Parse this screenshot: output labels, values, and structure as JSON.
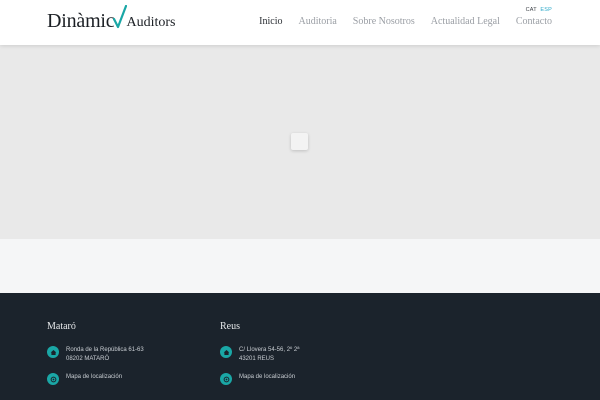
{
  "brand": {
    "name": "Dinàmic",
    "sub": "Auditors",
    "check_color": "#1aa7a6"
  },
  "languages": {
    "cat": "CAT",
    "esp": "ESP"
  },
  "nav": {
    "items": [
      {
        "label": "Inicio",
        "active": true
      },
      {
        "label": "Auditoria",
        "active": false
      },
      {
        "label": "Sobre Nosotros",
        "active": false
      },
      {
        "label": "Actualidad Legal",
        "active": false
      },
      {
        "label": "Contacto",
        "active": false
      }
    ]
  },
  "footer": {
    "offices": [
      {
        "name": "Mataró",
        "address_line1": "Ronda de la República 61-63",
        "address_line2": "08202 MATARÓ",
        "map_label": "Mapa de localización"
      },
      {
        "name": "Reus",
        "address_line1": "C/ Llovera 54-56, 2º 2ª",
        "address_line2": "43201 REUS",
        "map_label": "Mapa de localización"
      }
    ],
    "icon_color": "#1aa7a6",
    "background": "#1b232c"
  }
}
